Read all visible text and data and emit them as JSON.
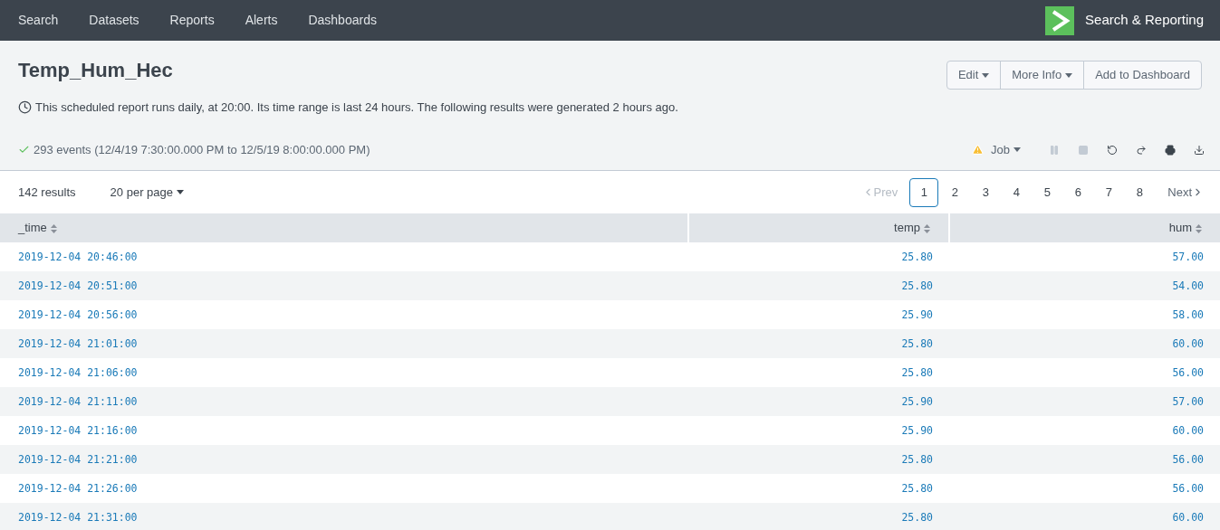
{
  "nav": {
    "items": [
      {
        "label": "Search",
        "selected": false
      },
      {
        "label": "Datasets",
        "selected": false
      },
      {
        "label": "Reports",
        "selected": false
      },
      {
        "label": "Alerts",
        "selected": false
      },
      {
        "label": "Dashboards",
        "selected": false
      }
    ],
    "app_name": "Search & Reporting"
  },
  "report": {
    "title": "Temp_Hum_Hec",
    "schedule": "This scheduled report runs daily, at 20:00. Its time range is last 24 hours. The following results were generated 2 hours ago.",
    "actions": [
      {
        "label": "Edit",
        "dropdown": true
      },
      {
        "label": "More Info",
        "dropdown": true
      },
      {
        "label": "Add to Dashboard",
        "dropdown": false
      }
    ]
  },
  "job": {
    "summary": "293 events (12/4/19 7:30:00.000 PM to 12/5/19 8:00:00.000 PM)",
    "label": "Job",
    "tools": [
      {
        "kind": "pause",
        "disabled": true
      },
      {
        "kind": "stop",
        "disabled": true
      },
      {
        "kind": "reload",
        "disabled": false
      },
      {
        "kind": "share",
        "disabled": false
      },
      {
        "kind": "print",
        "disabled": false
      },
      {
        "kind": "export",
        "disabled": false
      }
    ]
  },
  "results": {
    "count": "142 results",
    "per_page": "20 per page"
  },
  "pagination": {
    "prev": {
      "label": "Prev",
      "disabled": true
    },
    "pages": [
      {
        "label": "1",
        "selected": true
      },
      {
        "label": "2",
        "selected": false
      },
      {
        "label": "3",
        "selected": false
      },
      {
        "label": "4",
        "selected": false
      },
      {
        "label": "5",
        "selected": false
      },
      {
        "label": "6",
        "selected": false
      },
      {
        "label": "7",
        "selected": false
      },
      {
        "label": "8",
        "selected": false
      }
    ],
    "next": {
      "label": "Next",
      "disabled": false
    }
  },
  "table": {
    "columns": [
      "_time",
      "temp",
      "hum"
    ],
    "rows": [
      [
        "2019-12-04 20:46:00",
        "25.80",
        "57.00"
      ],
      [
        "2019-12-04 20:51:00",
        "25.80",
        "54.00"
      ],
      [
        "2019-12-04 20:56:00",
        "25.90",
        "58.00"
      ],
      [
        "2019-12-04 21:01:00",
        "25.80",
        "60.00"
      ],
      [
        "2019-12-04 21:06:00",
        "25.80",
        "56.00"
      ],
      [
        "2019-12-04 21:11:00",
        "25.90",
        "57.00"
      ],
      [
        "2019-12-04 21:16:00",
        "25.90",
        "60.00"
      ],
      [
        "2019-12-04 21:21:00",
        "25.80",
        "56.00"
      ],
      [
        "2019-12-04 21:26:00",
        "25.80",
        "56.00"
      ],
      [
        "2019-12-04 21:31:00",
        "25.80",
        "60.00"
      ]
    ]
  }
}
